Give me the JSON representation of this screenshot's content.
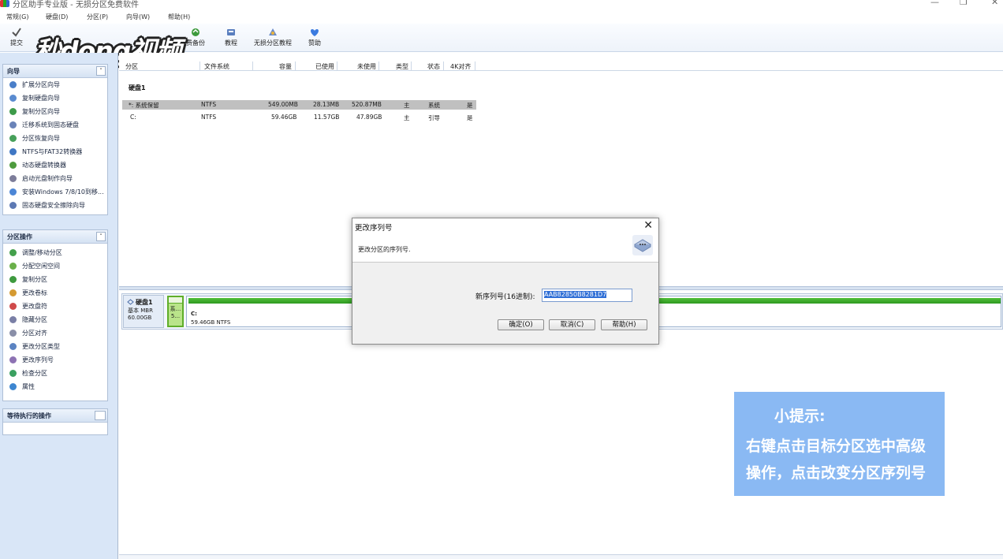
{
  "window": {
    "title": "分区助手专业版 - 无损分区免费软件"
  },
  "menu": [
    "常规(G)",
    "硬盘(D)",
    "分区(P)",
    "向导(W)",
    "帮助(H)"
  ],
  "toolbar": [
    {
      "label": "提交",
      "icon": "checkmark-icon"
    },
    {
      "label": "费备份",
      "icon": "backup-icon"
    },
    {
      "label": "教程",
      "icon": "tutorial-icon"
    },
    {
      "label": "无损分区教程",
      "icon": "partition-tutorial-icon"
    },
    {
      "label": "赞助",
      "icon": "heart-icon"
    }
  ],
  "watermark": {
    "text": "秒dong视频"
  },
  "sidebar": {
    "wizards": {
      "title": "向导",
      "items": [
        "扩展分区向导",
        "复制硬盘向导",
        "复制分区向导",
        "迁移系统到固态硬盘",
        "分区恢复向导",
        "NTFS与FAT32转换器",
        "动态硬盘转换器",
        "启动光盘制作向导",
        "安装Windows 7/8/10到移...",
        "固态硬盘安全擦除向导"
      ]
    },
    "operations": {
      "title": "分区操作",
      "items": [
        "调整/移动分区",
        "分配空闲空间",
        "复制分区",
        "更改卷标",
        "更改盘符",
        "隐藏分区",
        "分区对齐",
        "更改分区类型",
        "更改序列号",
        "检查分区",
        "属性"
      ]
    },
    "pending": {
      "title": "等待执行的操作"
    }
  },
  "table": {
    "columns": [
      "分区",
      "文件系统",
      "容量",
      "已使用",
      "未使用",
      "类型",
      "状态",
      "4K对齐"
    ],
    "disk_label": "硬盘1",
    "rows": [
      [
        "*: 系统保留",
        "NTFS",
        "549.00MB",
        "28.13MB",
        "520.87MB",
        "主",
        "系统",
        "是"
      ],
      [
        "C:",
        "NTFS",
        "59.46GB",
        "11.57GB",
        "47.89GB",
        "主",
        "引导",
        "是"
      ]
    ]
  },
  "diskmap": {
    "name": "硬盘1",
    "type": "基本 MBR",
    "size": "60.00GB",
    "sys_label": "系...",
    "sys_size": "5...",
    "c_label": "C:",
    "c_size": "59.46GB NTFS"
  },
  "dialog": {
    "title": "更改序列号",
    "description": "更改分区的序列号.",
    "field_label": "新序列号(16进制):",
    "field_value": "AAB82850B8281D7",
    "buttons": [
      "确定(O)",
      "取消(C)",
      "帮助(H)"
    ]
  },
  "tip": {
    "title": "小提示:",
    "lines": [
      "右键点击目标分区选中高级",
      "操作，点击改变分区序列号"
    ]
  }
}
